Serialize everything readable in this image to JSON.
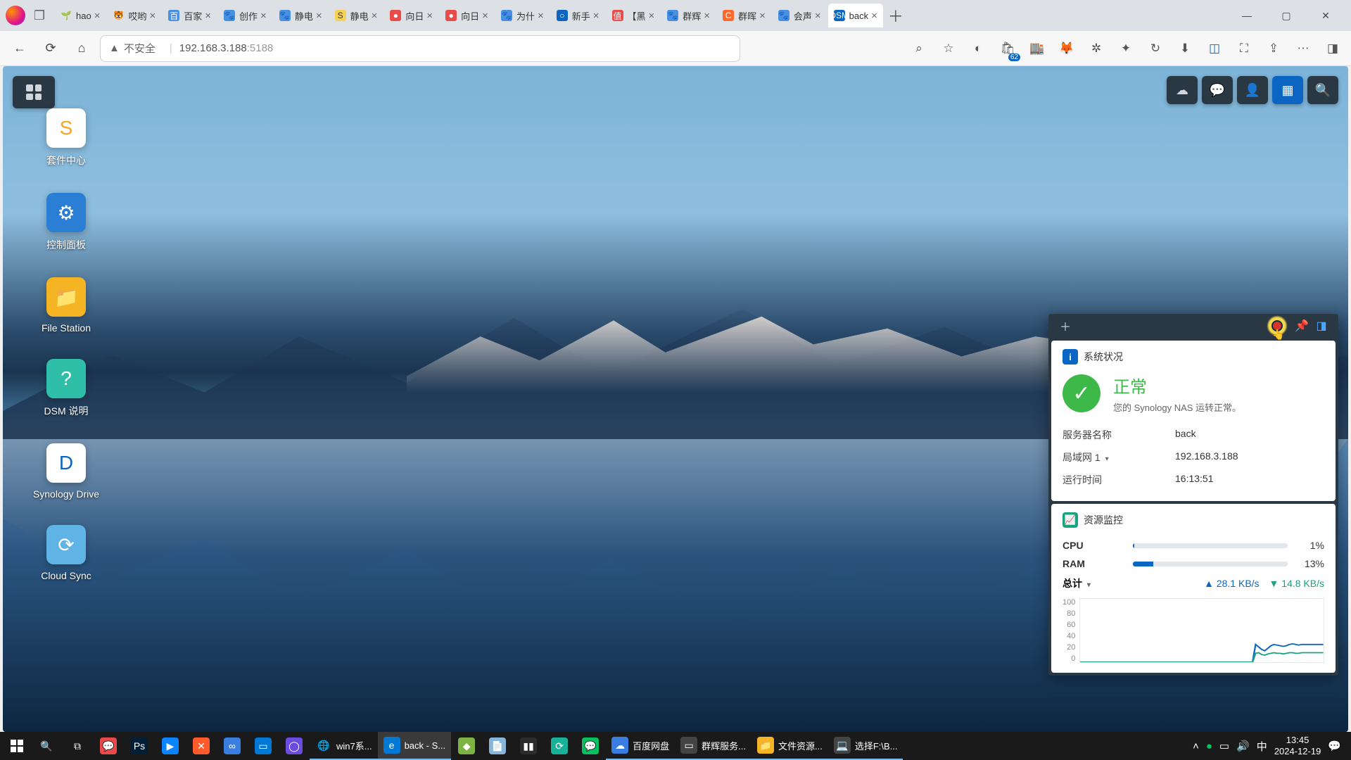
{
  "browser": {
    "tabs": [
      {
        "title": "hao",
        "favicon": "🌱",
        "fvClass": ""
      },
      {
        "title": "哎哟",
        "favicon": "🐯",
        "fvClass": ""
      },
      {
        "title": "百家",
        "favicon": "百",
        "fvClass": "fv-blue"
      },
      {
        "title": "创作",
        "favicon": "🐾",
        "fvClass": "fv-blue"
      },
      {
        "title": "静电",
        "favicon": "🐾",
        "fvClass": "fv-blue"
      },
      {
        "title": "静电",
        "favicon": "S",
        "fvClass": "fv-yellow"
      },
      {
        "title": "向日",
        "favicon": "●",
        "fvClass": "fv-red"
      },
      {
        "title": "向日",
        "favicon": "●",
        "fvClass": "fv-red"
      },
      {
        "title": "为什",
        "favicon": "🐾",
        "fvClass": "fv-blue"
      },
      {
        "title": "新手",
        "favicon": "○",
        "fvClass": "fv-azure"
      },
      {
        "title": "【黑",
        "favicon": "值",
        "fvClass": "fv-red"
      },
      {
        "title": "群辉",
        "favicon": "🐾",
        "fvClass": "fv-blue"
      },
      {
        "title": "群晖",
        "favicon": "C",
        "fvClass": "fv-corange"
      },
      {
        "title": "会声",
        "favicon": "🐾",
        "fvClass": "fv-blue"
      },
      {
        "title": "back",
        "favicon": "DSM",
        "fvClass": "fv-azure",
        "active": true
      }
    ],
    "security_label": "不安全",
    "url_host": "192.168.3.188",
    "url_port": ":5188"
  },
  "dsm": {
    "desktop_icons": [
      {
        "label": "套件中心",
        "bg": "linear-gradient(135deg,#fff,#fff)",
        "glyph": "S",
        "glyphColor": "#f5a623"
      },
      {
        "label": "控制面板",
        "bg": "#2a7fd4",
        "glyph": "⚙",
        "glyphColor": "#fff"
      },
      {
        "label": "File Station",
        "bg": "#f5b423",
        "glyph": "📁",
        "glyphColor": "#fff"
      },
      {
        "label": "DSM 说明",
        "bg": "#2fbfa8",
        "glyph": "?",
        "glyphColor": "#fff"
      },
      {
        "label": "Synology Drive",
        "bg": "#fff",
        "glyph": "D",
        "glyphColor": "#0a66c2"
      },
      {
        "label": "Cloud Sync",
        "bg": "#5fb4e5",
        "glyph": "⟳",
        "glyphColor": "#fff"
      }
    ],
    "widget": {
      "health_title": "系统状况",
      "status_main": "正常",
      "status_sub": "您的 Synology NAS 运转正常。",
      "rows": [
        {
          "label": "服务器名称",
          "value": "back"
        },
        {
          "label": "局域网 1",
          "value": "192.168.3.188",
          "dropdown": true
        },
        {
          "label": "运行时间",
          "value": "16:13:51"
        }
      ],
      "monitor_title": "资源监控",
      "cpu_label": "CPU",
      "cpu_pct": 1,
      "ram_label": "RAM",
      "ram_pct": 13,
      "net_label": "总计",
      "net_up": "28.1 KB/s",
      "net_down": "14.8 KB/s",
      "chart_ticks": [
        "100",
        "80",
        "60",
        "40",
        "20",
        "0"
      ]
    }
  },
  "chart_data": {
    "type": "line",
    "ylabel": "",
    "ylim": [
      0,
      100
    ],
    "y_ticks": [
      0,
      20,
      40,
      60,
      80,
      100
    ],
    "series": [
      {
        "name": "upload",
        "color": "#0a66c2",
        "values": [
          0,
          0,
          0,
          0,
          0,
          0,
          0,
          0,
          0,
          0,
          0,
          0,
          0,
          0,
          0,
          0,
          0,
          0,
          0,
          0,
          0,
          0,
          0,
          0,
          0,
          0,
          0,
          0,
          0,
          0,
          0,
          0,
          0,
          0,
          0,
          0,
          0,
          0,
          0,
          0,
          0,
          0,
          0,
          0,
          0,
          0,
          0,
          0,
          0,
          0,
          0,
          0,
          0,
          0,
          0,
          0,
          0,
          28,
          24,
          20,
          18,
          22,
          26,
          28,
          27,
          26,
          25,
          26,
          28,
          29,
          28,
          27,
          28,
          28,
          28,
          28,
          28,
          28,
          28,
          28
        ]
      },
      {
        "name": "download",
        "color": "#1aa380",
        "values": [
          0,
          0,
          0,
          0,
          0,
          0,
          0,
          0,
          0,
          0,
          0,
          0,
          0,
          0,
          0,
          0,
          0,
          0,
          0,
          0,
          0,
          0,
          0,
          0,
          0,
          0,
          0,
          0,
          0,
          0,
          0,
          0,
          0,
          0,
          0,
          0,
          0,
          0,
          0,
          0,
          0,
          0,
          0,
          0,
          0,
          0,
          0,
          0,
          0,
          0,
          0,
          0,
          0,
          0,
          0,
          0,
          0,
          14,
          15,
          12,
          11,
          13,
          14,
          15,
          14,
          14,
          13,
          14,
          15,
          15,
          14,
          14,
          15,
          15,
          15,
          15,
          15,
          15,
          15,
          15
        ]
      }
    ]
  },
  "taskbar": {
    "apps": [
      {
        "glyph": "⊞",
        "bg": "",
        "label": ""
      },
      {
        "glyph": "🔍",
        "bg": "",
        "label": ""
      },
      {
        "glyph": "⧉",
        "bg": "",
        "label": ""
      },
      {
        "glyph": "💬",
        "bg": "#e94b4b",
        "label": ""
      },
      {
        "glyph": "Ps",
        "bg": "#001e36",
        "label": ""
      },
      {
        "glyph": "▶",
        "bg": "#0a84ff",
        "label": ""
      },
      {
        "glyph": "✕",
        "bg": "#ff5a2c",
        "label": ""
      },
      {
        "glyph": "∞",
        "bg": "#3a7de0",
        "label": ""
      },
      {
        "glyph": "▭",
        "bg": "#0078d4",
        "label": ""
      },
      {
        "glyph": "◯",
        "bg": "#6b4ce0",
        "label": ""
      },
      {
        "glyph": "🌐",
        "bg": "",
        "label": "win7系...",
        "running": true
      },
      {
        "glyph": "e",
        "bg": "#0078d4",
        "label": "back - S...",
        "active": true
      },
      {
        "glyph": "◆",
        "bg": "#7cb342",
        "label": "",
        "running": true
      },
      {
        "glyph": "📄",
        "bg": "#88b5d8",
        "label": "",
        "running": true
      },
      {
        "glyph": "▮▮",
        "bg": "#2c2c2c",
        "label": "",
        "running": true
      },
      {
        "glyph": "⟳",
        "bg": "#18b29a",
        "label": "",
        "running": true
      },
      {
        "glyph": "💬",
        "bg": "#07c160",
        "label": "",
        "running": true
      },
      {
        "glyph": "☁",
        "bg": "#3a7de0",
        "label": "百度网盘",
        "running": true
      },
      {
        "glyph": "▭",
        "bg": "#444",
        "label": "群辉服务...",
        "running": true
      },
      {
        "glyph": "📁",
        "bg": "#f5b423",
        "label": "文件资源...",
        "running": true
      },
      {
        "glyph": "💻",
        "bg": "#444",
        "label": "选择F:\\B...",
        "running": true
      }
    ],
    "tray": {
      "ime": "中",
      "time": "13:45",
      "date": "2024-12-19"
    }
  }
}
